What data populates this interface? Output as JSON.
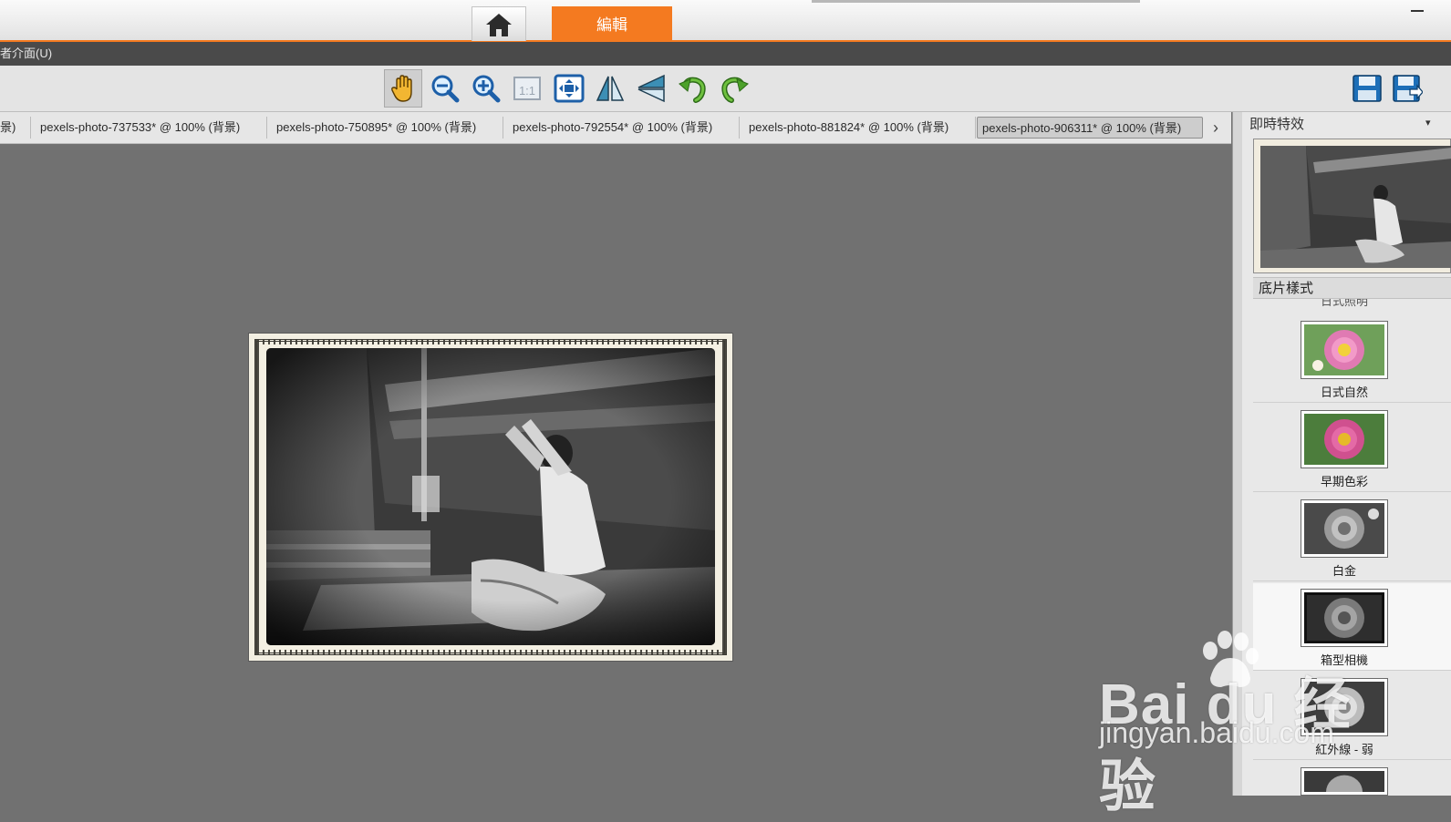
{
  "header": {
    "home_icon": "home-icon",
    "edit_tab_label": "編輯",
    "accent_color": "#f47a20"
  },
  "menu": {
    "partial_item": "者介面(U)"
  },
  "toolbar": {
    "tools": [
      {
        "name": "pan-hand-icon",
        "active": true
      },
      {
        "name": "zoom-out-icon"
      },
      {
        "name": "zoom-in-icon"
      },
      {
        "name": "actual-size-icon",
        "text": "1:1"
      },
      {
        "name": "fit-to-window-icon"
      },
      {
        "name": "flip-horizontal-icon"
      },
      {
        "name": "flip-vertical-icon"
      },
      {
        "name": "undo-icon"
      },
      {
        "name": "redo-icon"
      }
    ],
    "right_tools": [
      {
        "name": "save-icon"
      },
      {
        "name": "save-as-icon"
      }
    ]
  },
  "document_tabs": [
    {
      "label": "景)",
      "partial": true
    },
    {
      "label": "pexels-photo-737533* @ 100% (背景)"
    },
    {
      "label": "pexels-photo-750895* @ 100% (背景)"
    },
    {
      "label": "pexels-photo-792554* @ 100% (背景)"
    },
    {
      "label": "pexels-photo-881824* @ 100% (背景)"
    },
    {
      "label": "pexels-photo-906311* @ 100% (背景)",
      "active": true
    }
  ],
  "panel": {
    "title": "即時特效",
    "section_title": "底片樣式",
    "cut_label": "日式照明",
    "effects": [
      {
        "label": "日式自然",
        "style": "color-natural"
      },
      {
        "label": "早期色彩",
        "style": "color-early"
      },
      {
        "label": "白金",
        "style": "platinum"
      },
      {
        "label": "箱型相機",
        "style": "box-camera",
        "selected": true
      },
      {
        "label": "紅外線 - 弱",
        "style": "infrared"
      }
    ]
  },
  "watermark": {
    "brand": "Bai du 经验",
    "url": "jingyan.baidu.com"
  }
}
